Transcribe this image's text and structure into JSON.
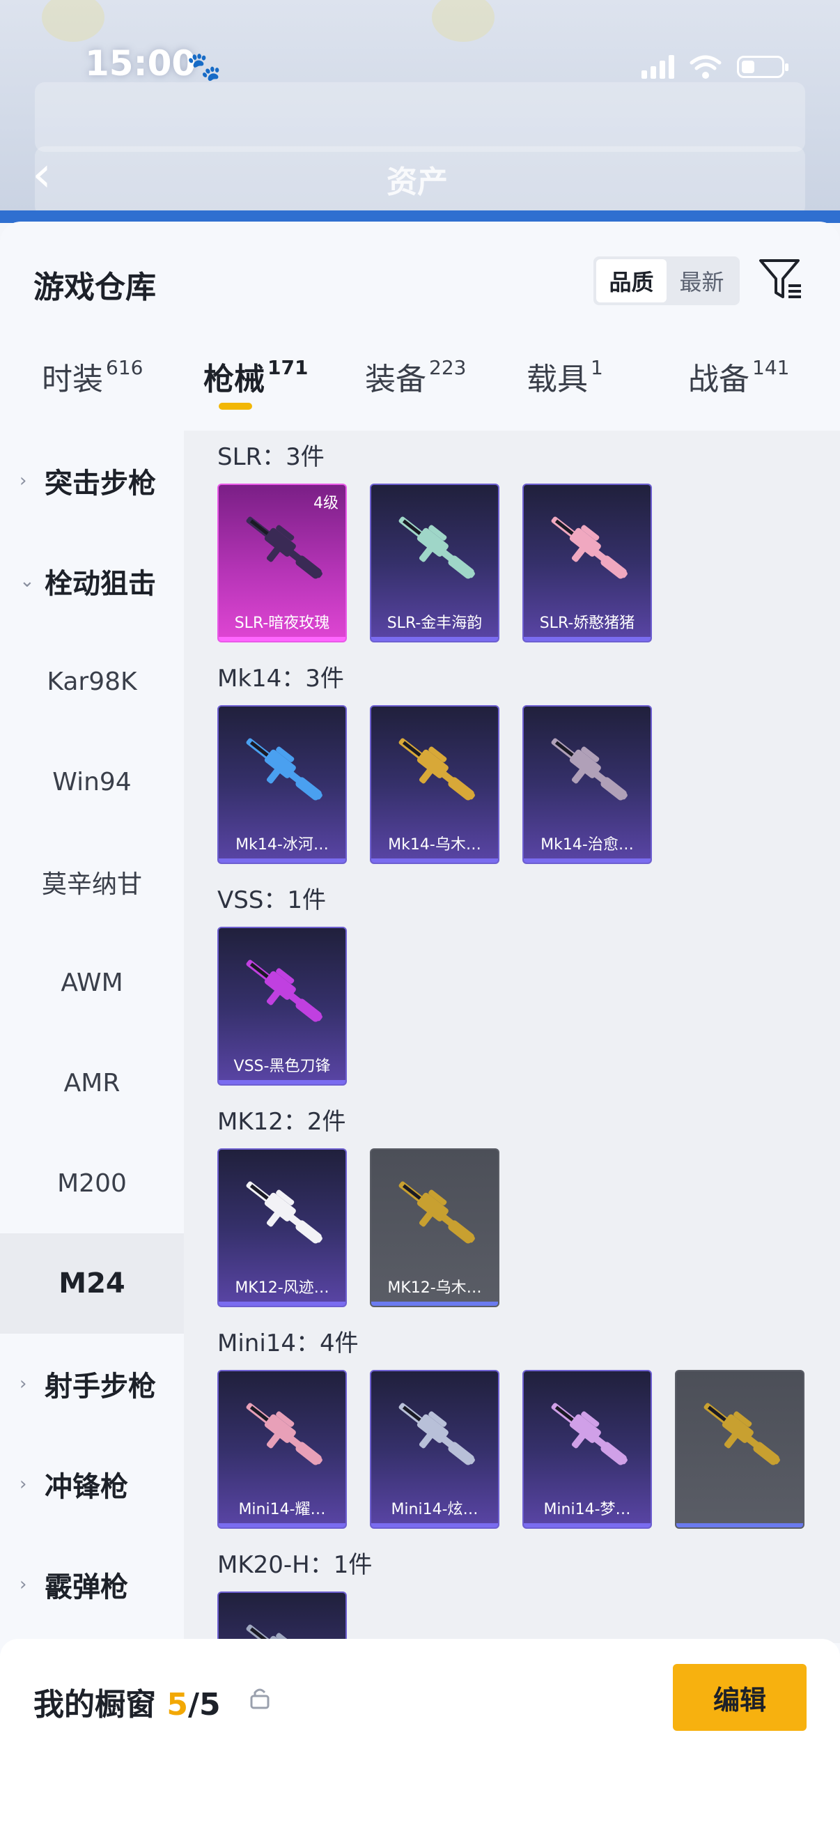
{
  "status_bar": {
    "time": "15:00"
  },
  "header": {
    "title": "资产"
  },
  "warehouse": {
    "title": "游戏仓库",
    "sort": {
      "quality": "品质",
      "newest": "最新"
    }
  },
  "tabs": [
    {
      "label": "时装",
      "count": "616"
    },
    {
      "label": "枪械",
      "count": "171"
    },
    {
      "label": "装备",
      "count": "223"
    },
    {
      "label": "载具",
      "count": "1"
    },
    {
      "label": "战备",
      "count": "141"
    }
  ],
  "sidebar": {
    "items": [
      {
        "label": "突击步枪"
      },
      {
        "label": "栓动狙击"
      },
      {
        "label": "Kar98K"
      },
      {
        "label": "Win94"
      },
      {
        "label": "莫辛纳甘"
      },
      {
        "label": "AWM"
      },
      {
        "label": "AMR"
      },
      {
        "label": "M200"
      },
      {
        "label": "M24"
      },
      {
        "label": "射手步枪"
      },
      {
        "label": "冲锋枪"
      },
      {
        "label": "霰弹枪"
      }
    ]
  },
  "sections": [
    {
      "title": "SLR：3件",
      "items": [
        {
          "name": "SLR-暗夜玫瑰",
          "level": "4级",
          "rarity": "pink",
          "color": "#3a2a55"
        },
        {
          "name": "SLR-金丰海韵",
          "rarity": "purple",
          "color": "#9fd6c8"
        },
        {
          "name": "SLR-娇憨猪猪",
          "rarity": "purple",
          "color": "#f0a8c0"
        }
      ]
    },
    {
      "title": "Mk14：3件",
      "items": [
        {
          "name": "Mk14-冰河…",
          "rarity": "purple",
          "color": "#4aa0f0"
        },
        {
          "name": "Mk14-乌木…",
          "rarity": "purple",
          "color": "#d8a838"
        },
        {
          "name": "Mk14-治愈…",
          "rarity": "purple",
          "color": "#b0a0b8"
        }
      ]
    },
    {
      "title": "VSS：1件",
      "items": [
        {
          "name": "VSS-黑色刀锋",
          "rarity": "purple",
          "color": "#c040e0"
        }
      ]
    },
    {
      "title": "MK12：2件",
      "items": [
        {
          "name": "MK12-风迹…",
          "rarity": "purple",
          "color": "#f2f2f6"
        },
        {
          "name": "MK12-乌木…",
          "rarity": "gray",
          "color": "#c8a030"
        }
      ]
    },
    {
      "title": "Mini14：4件",
      "items": [
        {
          "name": "Mini14-耀…",
          "rarity": "purple",
          "color": "#e8a0b8"
        },
        {
          "name": "Mini14-炫…",
          "rarity": "purple",
          "color": "#b8c0d8"
        },
        {
          "name": "Mini14-梦…",
          "rarity": "purple",
          "color": "#d0a0e8"
        },
        {
          "name": "",
          "rarity": "gray",
          "color": "#c8a030"
        }
      ]
    },
    {
      "title": "MK20-H：1件",
      "items": [
        {
          "name": "",
          "rarity": "purple",
          "color": "#a0a8c0"
        }
      ]
    }
  ],
  "showcase": {
    "label": "我的橱窗",
    "current": "5",
    "total": "/5",
    "edit": "编辑"
  },
  "colors": {
    "accent": "#f2b705",
    "pink_rarity": "#d23fcf",
    "purple_rarity": "#5a45a6"
  }
}
